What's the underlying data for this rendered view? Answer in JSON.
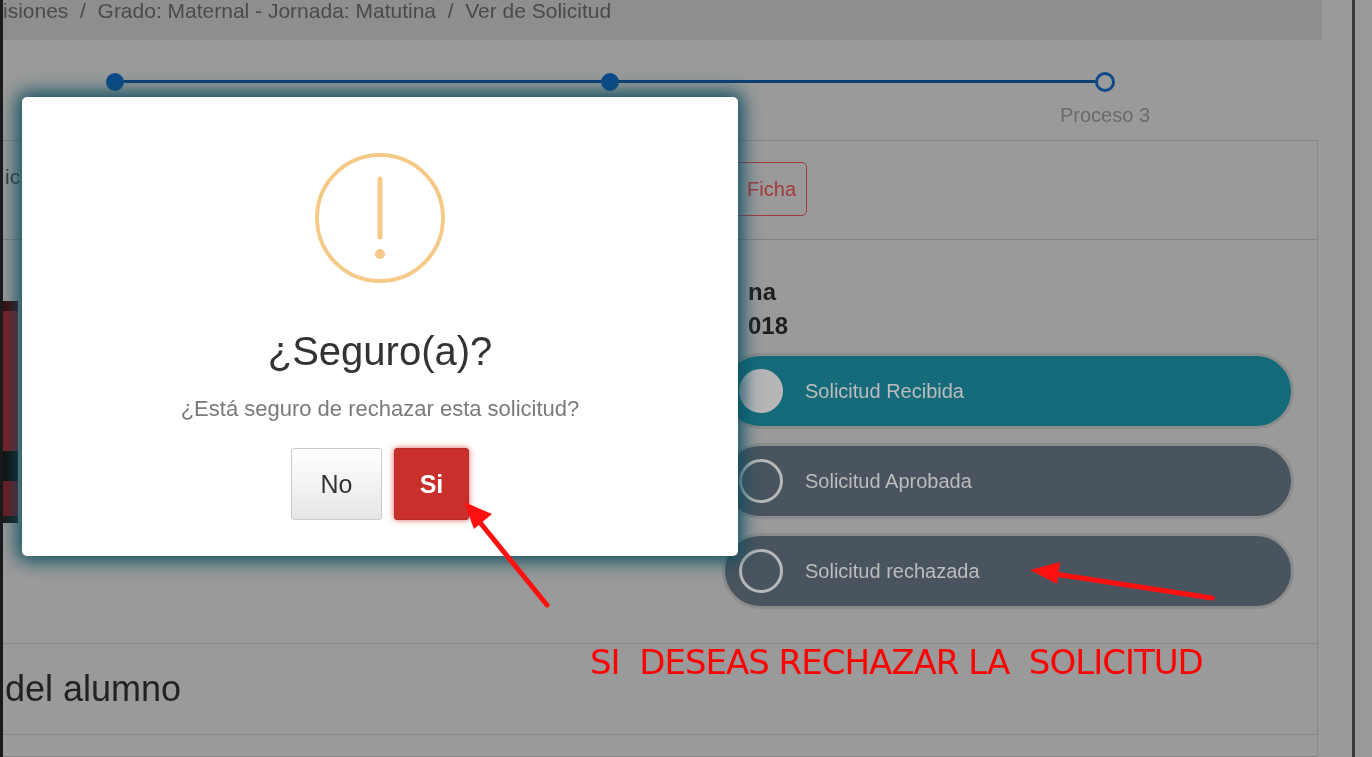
{
  "breadcrumb": {
    "text": "isiones  /  Grado: Maternal - Jornada: Matutina  /  Ver de Solicitud"
  },
  "stepper": {
    "steps": [
      {
        "done": true
      },
      {
        "done": true
      },
      {
        "done": false,
        "label": "Proceso 3"
      }
    ]
  },
  "panel": {
    "header_fragment": "ic",
    "ficha_button": "Ficha",
    "info_lines": [
      "na",
      "018"
    ],
    "statuses": [
      {
        "label": "Solicitud Recibida",
        "selected": true
      },
      {
        "label": "Solicitud Aprobada",
        "selected": false
      },
      {
        "label": "Solicitud rechazada",
        "selected": false
      }
    ],
    "section_title": "del alumno"
  },
  "dialog": {
    "title": "¿Seguro(a)?",
    "message": "¿Está seguro de rechazar esta solicitud?",
    "buttons": [
      {
        "label": "No",
        "kind": "cancel"
      },
      {
        "label": "Si",
        "kind": "confirm"
      }
    ]
  },
  "annotation": {
    "text": "SI  DESEAS RECHAZAR LA  SOLICITUD"
  }
}
